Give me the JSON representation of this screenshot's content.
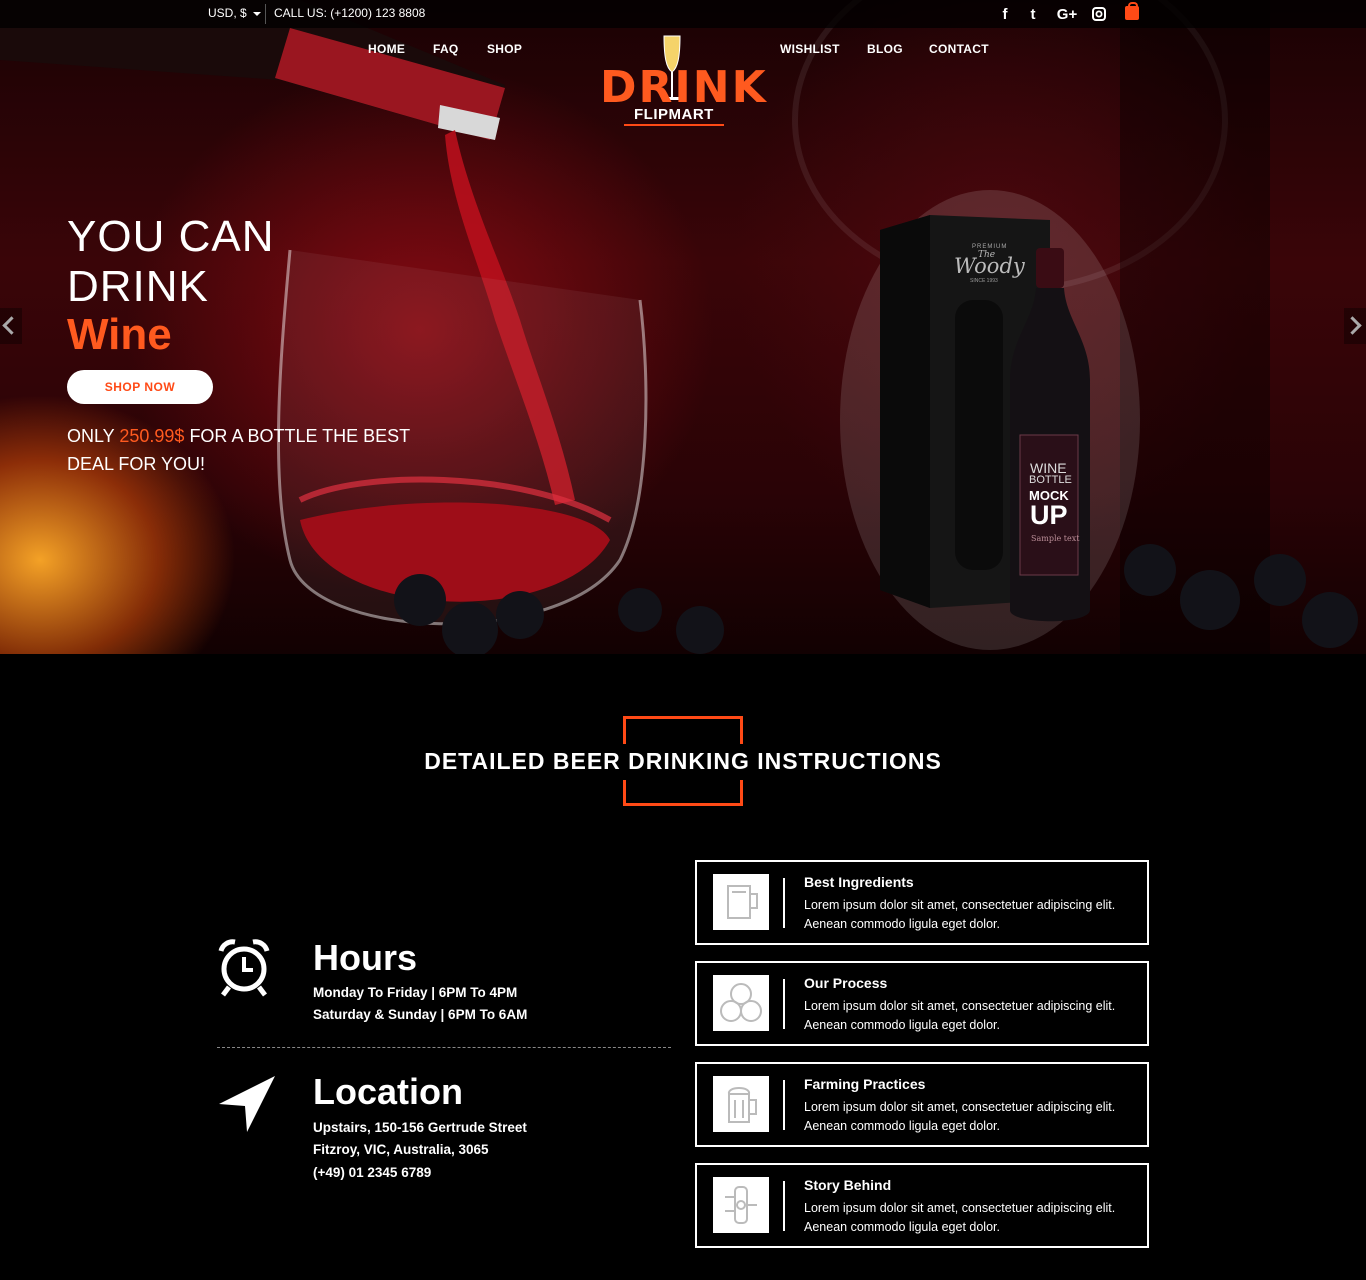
{
  "topbar": {
    "currency": "USD, $",
    "call_us": "CALL US: (+1200) 123 8808",
    "social": [
      {
        "icon": "facebook-icon",
        "glyph": "f"
      },
      {
        "icon": "twitter-icon",
        "glyph": "t"
      },
      {
        "icon": "google-plus-icon",
        "glyph": "G+"
      },
      {
        "icon": "instagram-icon",
        "glyph": ""
      },
      {
        "icon": "shopping-bag-icon",
        "glyph": ""
      }
    ]
  },
  "nav": {
    "left": [
      "HOME",
      "FAQ",
      "SHOP"
    ],
    "right": [
      "WISHLIST",
      "BLOG",
      "CONTACT"
    ]
  },
  "logo": {
    "main": "DRINK",
    "sub": "FLIPMART"
  },
  "hero": {
    "line1": "YOU CAN",
    "line2": "DRINK",
    "line3": "Wine",
    "button": "SHOP NOW",
    "promo_before": "ONLY ",
    "promo_price": "250.99$",
    "promo_after": " FOR A BOTTLE THE BEST DEAL FOR YOU!",
    "box_label_brand": "Woody",
    "box_label_top": "PREMIUM",
    "box_label_the": "The",
    "box_label_since": "SINCE 1993",
    "bottle_label_l1": "WINE",
    "bottle_label_l2": "BOTTLE",
    "bottle_label_l3": "MOCK",
    "bottle_label_l4": "UP",
    "bottle_label_small": "Sample text"
  },
  "section": {
    "title": "DETAILED BEER DRINKING INSTRUCTIONS"
  },
  "hours": {
    "title": "Hours",
    "line1": "Monday To Friday | 6PM To 4PM",
    "line2": "Saturday & Sunday | 6PM To 6AM"
  },
  "location": {
    "title": "Location",
    "line1": "Upstairs, 150-156 Gertrude Street",
    "line2": "Fitzroy, VIC, Australia, 3065",
    "line3": "(+49) 01 2345 6789"
  },
  "cards": [
    {
      "icon": "beer-mug-icon",
      "title": "Best Ingredients",
      "text": "Lorem ipsum dolor sit amet, consectetuer adipiscing elit. Aenean commodo ligula eget dolor."
    },
    {
      "icon": "barrels-icon",
      "title": "Our Process",
      "text": "Lorem ipsum dolor sit amet, consectetuer adipiscing elit. Aenean commodo ligula eget dolor."
    },
    {
      "icon": "foamy-beer-icon",
      "title": "Farming Practices",
      "text": "Lorem ipsum dolor sit amet, consectetuer adipiscing elit. Aenean commodo ligula eget dolor."
    },
    {
      "icon": "brewing-tank-icon",
      "title": "Story Behind",
      "text": "Lorem ipsum dolor sit amet, consectetuer adipiscing elit. Aenean commodo ligula eget dolor."
    }
  ],
  "colors": {
    "accent": "#ff4a16",
    "background": "#000000"
  }
}
